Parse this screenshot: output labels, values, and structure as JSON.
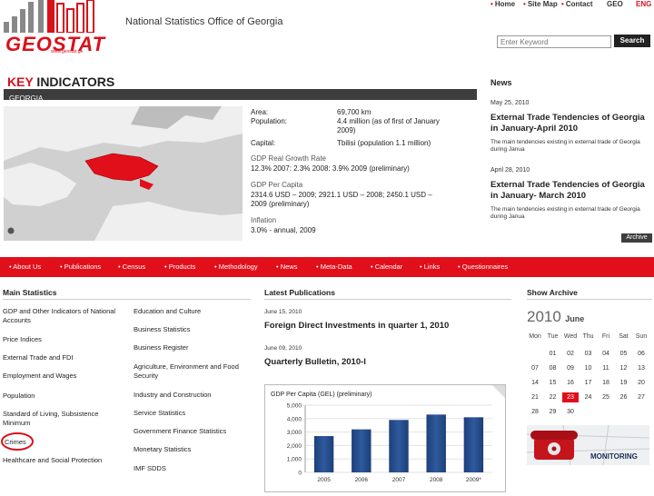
{
  "header": {
    "logo_text": "GEOSTAT",
    "logo_sub": "www.geostat.ge",
    "office_name": "National Statistics Office of Georgia",
    "top_nav": [
      "Home",
      "Site Map",
      "Contact"
    ],
    "lang_geo": "GEO",
    "lang_eng": "ENG",
    "search_placeholder": "Enter Keyword",
    "search_button": "Search"
  },
  "key_indicators": {
    "title_red": "KEY",
    "title_black": " INDICATORS",
    "region": "GEORGIA",
    "area_label": "Area:",
    "area_value": "69,700 km",
    "population_label": "Population:",
    "population_value_1": "4.4 million (as of first of January",
    "population_value_2": "2009)",
    "capital_label": "Capital:",
    "capital_value": "Tbilisi (population 1.1 million)",
    "gdp_growth_label": "GDP Real Growth Rate",
    "gdp_growth_value": "12.3% 2007: 2.3% 2008: 3.9% 2009 (preliminary)",
    "gdp_per_capita_label": "GDP Per Capita",
    "gdp_per_capita_value_1": "2314.6 USD – 2009; 2921.1 USD – 2008; 2450.1 USD –",
    "gdp_per_capita_value_2": "2009 (preliminary)",
    "inflation_label": "Inflation",
    "inflation_value": "3.0% - annual, 2009"
  },
  "news": {
    "title": "News",
    "items": [
      {
        "date": "May 25, 2010",
        "headline": "External Trade Tendencies of Georgia in January-April 2010",
        "body": "The main tendencies existing in external trade of Georgia during Janua"
      },
      {
        "date": "April 28, 2010",
        "headline": "External Trade Tendencies of Georgia in January- March 2010",
        "body": "The main tendencies existing in external trade of Georgia during Janua"
      }
    ],
    "archive_button": "Archive"
  },
  "main_nav": [
    "About Us",
    "Publications",
    "Census",
    "Products",
    "Methodology",
    "News",
    "Meta-Data",
    "Calendar",
    "Links",
    "Questionnaires"
  ],
  "main_statistics": {
    "title": "Main Statistics",
    "left": [
      "GDP and Other Indicators of National Accounts",
      "Price Indices",
      "External Trade and FDI",
      "Employment and Wages",
      "Population",
      "Standard of Living, Subsistence Minimum",
      "Crimes",
      "Healthcare and Social Protection"
    ],
    "right": [
      "Education and Culture",
      "Business Statistics",
      "Business Register",
      "Agriculture, Environment and Food Security",
      "Industry and Construction",
      "Service Statistics",
      "Government Finance Statistics",
      "Monetary Statistics",
      "IMF SDDS"
    ]
  },
  "latest_publications": {
    "title": "Latest Publications",
    "items": [
      {
        "date": "June 15, 2010",
        "headline": "Foreign Direct Investments in quarter 1, 2010"
      },
      {
        "date": "June 09, 2010",
        "headline": "Quarterly Bulletin, 2010-I"
      }
    ]
  },
  "chart_data": {
    "type": "bar",
    "title": "GDP Per Capita (GEL) (preliminary)",
    "categories": [
      "2005",
      "2006",
      "2007",
      "2008",
      "2009*"
    ],
    "values": [
      2700,
      3200,
      3900,
      4300,
      4100
    ],
    "ylim": [
      0,
      5000
    ],
    "yticks": [
      "5,000",
      "4,000",
      "3,000",
      "2,000",
      "1,000",
      "0"
    ],
    "bar_color": "#2e5a9c"
  },
  "archive": {
    "title": "Show Archive",
    "year": "2010",
    "month": "June",
    "weekdays": [
      "Mon",
      "Tue",
      "Wed",
      "Thu",
      "Fri",
      "Sat",
      "Sun"
    ],
    "days": [
      [
        "",
        "01",
        "02",
        "03",
        "04",
        "05",
        "06"
      ],
      [
        "07",
        "08",
        "09",
        "10",
        "11",
        "12",
        "13"
      ],
      [
        "14",
        "15",
        "16",
        "17",
        "18",
        "19",
        "20"
      ],
      [
        "21",
        "22",
        "23",
        "24",
        "25",
        "26",
        "27"
      ],
      [
        "28",
        "29",
        "30",
        "",
        "",
        "",
        ""
      ]
    ],
    "highlight_day": "23",
    "monitoring_label": "MONITORING"
  }
}
